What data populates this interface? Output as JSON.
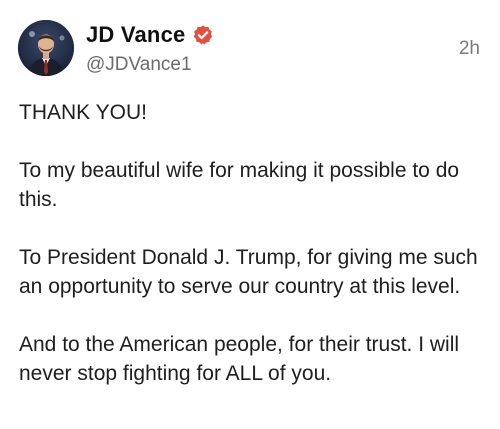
{
  "post": {
    "author": {
      "display_name": "JD Vance",
      "handle": "@JDVance1",
      "verified": true,
      "verified_badge_color": "#e0513f",
      "avatar": "profile-photo"
    },
    "timestamp": "2h",
    "paragraphs": [
      "THANK YOU!",
      "To my beautiful wife for making it possible to do this.",
      "To President Donald J. Trump, for giving me such an opportunity to serve our country at this level.",
      "And to the American people, for their trust. I will never stop fighting for ALL of you."
    ]
  },
  "colors": {
    "background": "#ffffff",
    "text": "#1e1e1e",
    "secondary_text": "#6b6b6b",
    "verified_badge": "#e0513f"
  }
}
